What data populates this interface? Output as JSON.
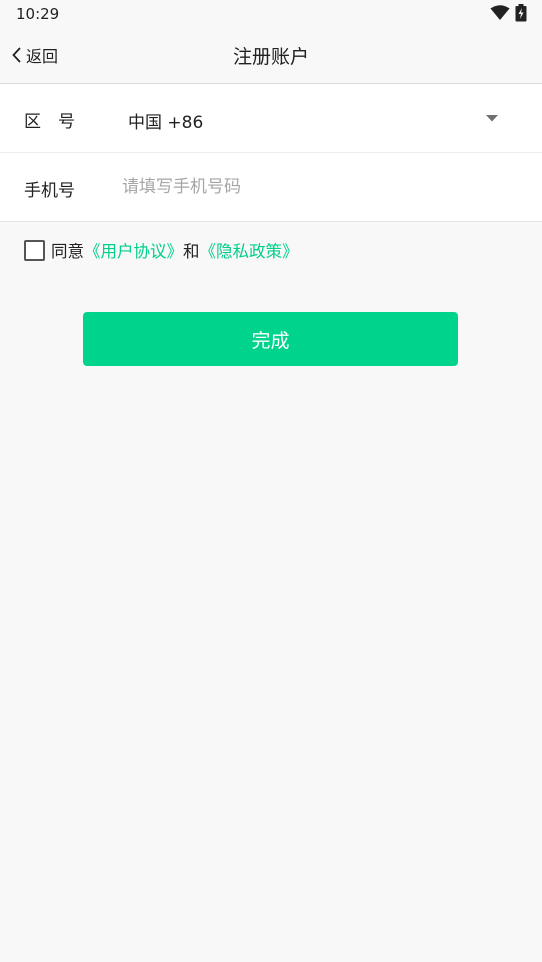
{
  "status_bar": {
    "time": "10:29",
    "icons": [
      "wifi-icon",
      "battery-icon"
    ]
  },
  "nav": {
    "back_label": "返回",
    "title": "注册账户",
    "back_icon": "chevron-left-icon"
  },
  "form": {
    "region": {
      "label": "区　号",
      "value": "中国 +86",
      "icon": "dropdown-arrow-icon"
    },
    "phone": {
      "label": "手机号",
      "value": "",
      "placeholder": "请填写手机号码"
    }
  },
  "agreement": {
    "checked": false,
    "prefix": "同意",
    "user_agreement": "《用户协议》",
    "conjunction": "和",
    "privacy_policy": "《隐私政策》"
  },
  "submit_label": "完成",
  "colors": {
    "accent": "#00d48c",
    "link": "#00cf8a",
    "background": "#f8f8f8",
    "card": "#ffffff",
    "placeholder": "#a6a6a6"
  }
}
